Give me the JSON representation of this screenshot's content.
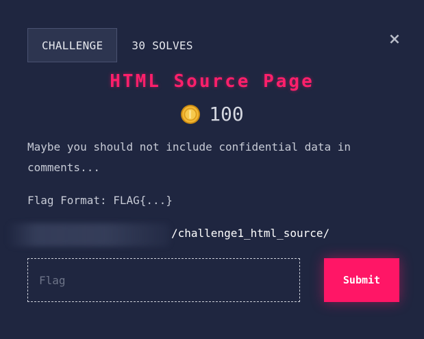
{
  "tabs": [
    {
      "label": "CHALLENGE"
    },
    {
      "label": "30 SOLVES"
    }
  ],
  "close_icon": "×",
  "challenge": {
    "title": "HTML Source Page",
    "points": "100",
    "description": "Maybe you should not include confidential data in comments...",
    "flag_format": "Flag Format: FLAG{...}",
    "url_path": "/challenge1_html_source/"
  },
  "form": {
    "placeholder": "Flag",
    "submit_label": "Submit"
  },
  "colors": {
    "background": "#1f2640",
    "accent": "#ff1666",
    "coin": "#f2b632"
  },
  "icons": {
    "coin": "coin-icon",
    "close": "close-icon"
  }
}
